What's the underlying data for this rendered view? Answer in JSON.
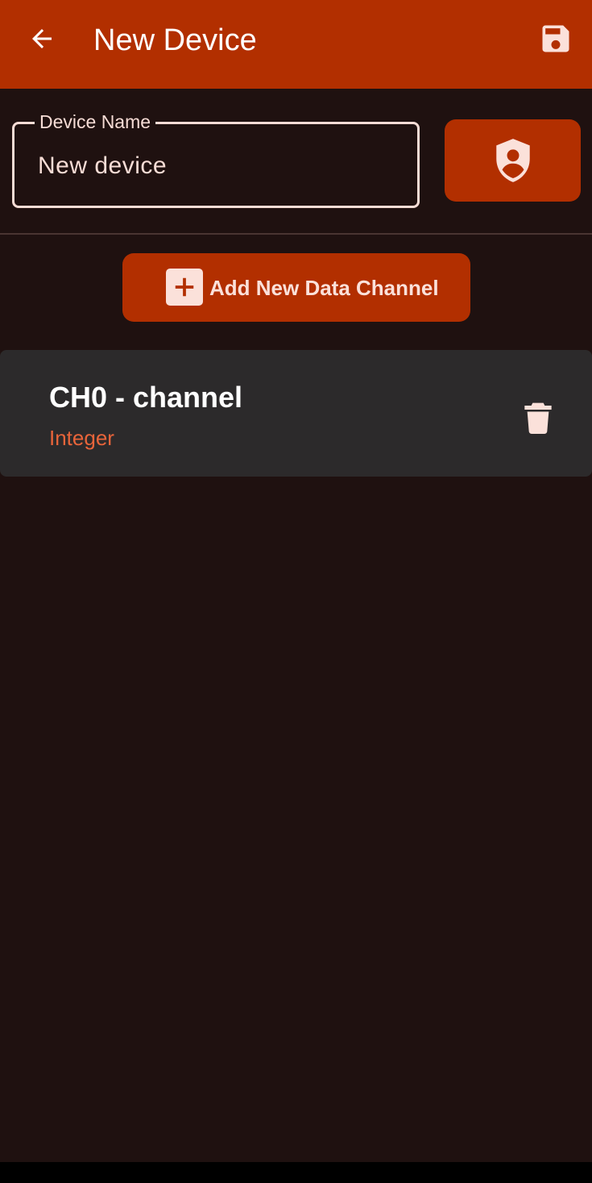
{
  "appbar": {
    "title": "New Device",
    "back_icon": "arrow-back-icon",
    "save_icon": "save-icon"
  },
  "device_name": {
    "label": "Device Name",
    "value": "New device"
  },
  "security_button": {
    "icon": "shield-person-icon"
  },
  "add_channel": {
    "label": "Add New Data Channel",
    "icon": "add-box-icon"
  },
  "channels": [
    {
      "title": "CH0 - channel",
      "type": "Integer",
      "delete_icon": "delete-icon"
    }
  ],
  "colors": {
    "primary": "#b22f00",
    "background": "#1f1110",
    "card": "#2c2a2b",
    "accent_text": "#e8643a",
    "on_primary": "#fbe1da"
  }
}
